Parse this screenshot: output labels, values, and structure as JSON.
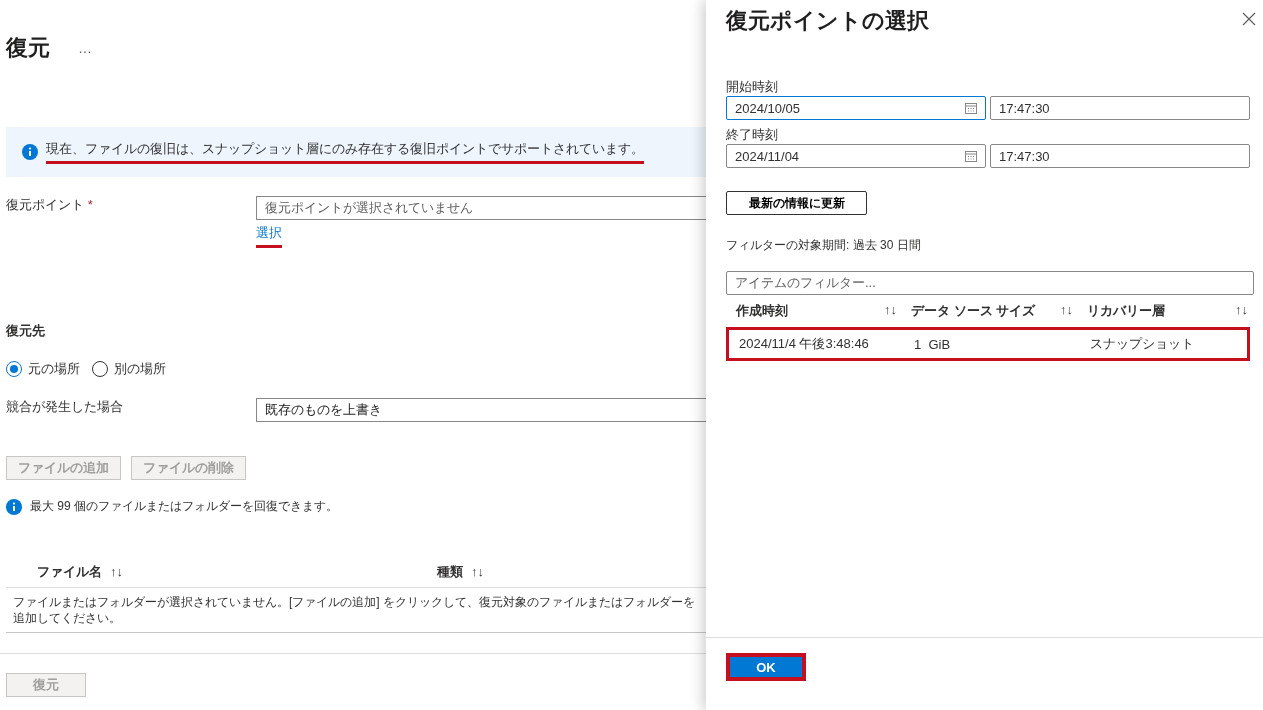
{
  "page": {
    "title": "復元",
    "more": "…",
    "banner": {
      "text": "現在、ファイルの復旧は、スナップショット層にのみ存在する復旧ポイントでサポートされています。",
      "underlined": true
    },
    "restore_point": {
      "label": "復元ポイント",
      "required": "*",
      "placeholder": "復元ポイントが選択されていません",
      "link": "選択",
      "link_underlined": true
    },
    "destination": {
      "heading": "復元先",
      "options": [
        {
          "label": "元の場所",
          "selected": true
        },
        {
          "label": "別の場所",
          "selected": false
        }
      ]
    },
    "conflict": {
      "label": "競合が発生した場合",
      "value": "既存のものを上書き"
    },
    "file_buttons": [
      {
        "label": "ファイルの追加",
        "disabled": true
      },
      {
        "label": "ファイルの削除",
        "disabled": true
      }
    ],
    "info": "最大 99 個のファイルまたはフォルダーを回復できます。",
    "table": {
      "columns": [
        {
          "label": "ファイル名",
          "sort": "↑↓"
        },
        {
          "label": "種類",
          "sort": "↑↓"
        }
      ],
      "empty": "ファイルまたはフォルダーが選択されていません。[ファイルの追加] をクリックして、復元対象のファイルまたはフォルダーを追加してください。"
    },
    "restore_button": {
      "label": "復元",
      "disabled": true
    }
  },
  "panel": {
    "title": "復元ポイントの選択",
    "ranges": [
      {
        "label": "開始時刻",
        "date": "2024/10/05",
        "time": "17:47:30",
        "focused": true
      },
      {
        "label": "終了時刻",
        "date": "2024/11/04",
        "time": "17:47:30",
        "focused": false
      }
    ],
    "refresh_button": "最新の情報に更新",
    "filter_period": "フィルターの対象期間: 過去 30 日間",
    "filter": {
      "placeholder": "アイテムのフィルター..."
    },
    "table": {
      "columns": [
        {
          "label": "作成時刻",
          "sort": "↑↓"
        },
        {
          "label": "データ ソース サイズ",
          "sort": "↑↓"
        },
        {
          "label": "リカバリー層",
          "sort": "↑↓"
        }
      ],
      "rows": [
        {
          "cells": [
            "2024/11/4 午後3:48:46",
            "1  GiB",
            "スナップショット"
          ],
          "highlighted": true
        }
      ]
    },
    "ok_button": {
      "label": "OK",
      "highlighted": true
    }
  }
}
